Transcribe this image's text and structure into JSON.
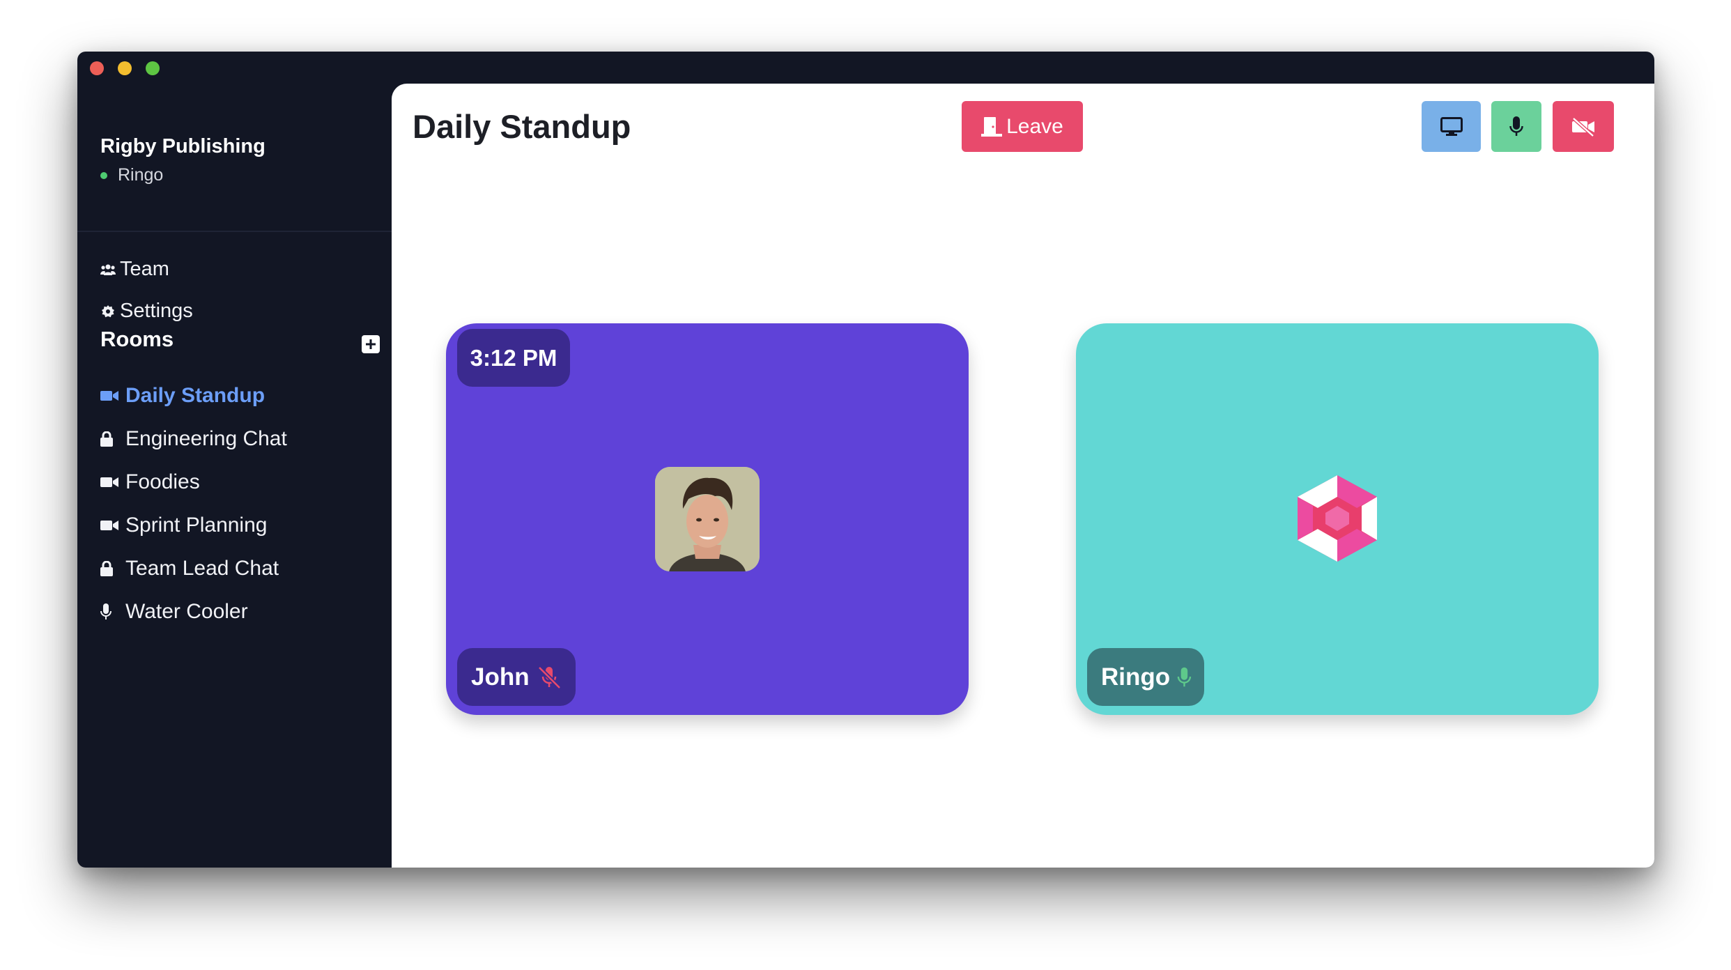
{
  "workspace": {
    "name": "Rigby Publishing",
    "current_user": "Ringo",
    "status_color": "#4ecb71"
  },
  "nav": {
    "team_label": "Team",
    "settings_label": "Settings"
  },
  "rooms": {
    "title": "Rooms",
    "add_icon": "plus-square-icon",
    "items": [
      {
        "label": "Daily Standup",
        "icon": "video-icon",
        "active": true
      },
      {
        "label": "Engineering Chat",
        "icon": "lock-icon",
        "active": false
      },
      {
        "label": "Foodies",
        "icon": "video-icon",
        "active": false
      },
      {
        "label": "Sprint Planning",
        "icon": "video-icon",
        "active": false
      },
      {
        "label": "Team Lead Chat",
        "icon": "lock-icon",
        "active": false
      },
      {
        "label": "Water Cooler",
        "icon": "microphone-icon",
        "active": false
      }
    ]
  },
  "call": {
    "title": "Daily Standup",
    "leave_label": "Leave",
    "controls": [
      {
        "name": "screen-share",
        "icon": "monitor-icon",
        "color": "#79b0e8"
      },
      {
        "name": "microphone",
        "icon": "microphone-icon",
        "color": "#6bd19b"
      },
      {
        "name": "camera",
        "icon": "video-off-icon",
        "color": "#e84a6c"
      }
    ],
    "participants": [
      {
        "name": "John",
        "muted": true,
        "time": "3:12 PM",
        "tile_color": "#5f42d8"
      },
      {
        "name": "Ringo",
        "muted": false,
        "tile_color": "#62d7d4"
      }
    ]
  },
  "accent_colors": {
    "active_room": "#6c9ef7",
    "leave": "#e84a6c"
  }
}
